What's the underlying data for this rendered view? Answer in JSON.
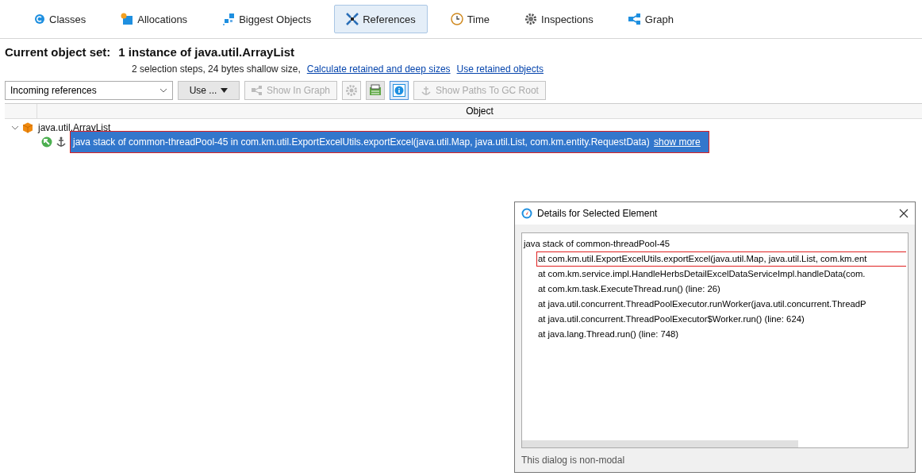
{
  "tabs": [
    {
      "label": "Classes",
      "selected": false
    },
    {
      "label": "Allocations",
      "selected": false
    },
    {
      "label": "Biggest Objects",
      "selected": false
    },
    {
      "label": "References",
      "selected": true
    },
    {
      "label": "Time",
      "selected": false
    },
    {
      "label": "Inspections",
      "selected": false
    },
    {
      "label": "Graph",
      "selected": false
    }
  ],
  "object_set": {
    "heading": "Current object set:",
    "value": "1 instance of java.util.ArrayList",
    "summary": "2 selection steps, 24 bytes shallow size,",
    "links": [
      "Calculate retained and deep sizes",
      "Use retained objects"
    ]
  },
  "toolbar": {
    "dropdown": {
      "value": "Incoming references"
    },
    "items": [
      {
        "kind": "menu",
        "label": "Use ...",
        "disabled": false
      },
      {
        "kind": "button",
        "label": "Show In Graph",
        "disabled": true
      },
      {
        "kind": "icon",
        "disabled": true,
        "selected": false
      },
      {
        "kind": "icon",
        "disabled": false,
        "selected": false
      },
      {
        "kind": "icon",
        "disabled": false,
        "selected": true
      },
      {
        "kind": "button",
        "label": "Show Paths To GC Root",
        "disabled": true
      }
    ]
  },
  "table": {
    "columns": [
      "Object"
    ],
    "rows": [
      {
        "label": "java.util.ArrayList",
        "expanded": true,
        "children": [
          {
            "label": "java stack of common-threadPool-45 in com.km.util.ExportExcelUtils.exportExcel(java.util.Map, java.util.List, com.km.entity.RequestData)",
            "link": "show more",
            "selected": true,
            "highlighted": true
          }
        ]
      }
    ]
  },
  "dialog": {
    "title": "Details for Selected Element",
    "lines": [
      {
        "text": "java stack of common-threadPool-45",
        "highlighted": false
      },
      {
        "text": "at com.km.util.ExportExcelUtils.exportExcel(java.util.Map, java.util.List, com.km.ent",
        "highlighted": true
      },
      {
        "text": "at com.km.service.impl.HandleHerbsDetailExcelDataServiceImpl.handleData(com.",
        "highlighted": false
      },
      {
        "text": "at com.km.task.ExecuteThread.run() (line: 26)",
        "highlighted": false
      },
      {
        "text": "at java.util.concurrent.ThreadPoolExecutor.runWorker(java.util.concurrent.ThreadP",
        "highlighted": false
      },
      {
        "text": "at java.util.concurrent.ThreadPoolExecutor$Worker.run() (line: 624)",
        "highlighted": false
      },
      {
        "text": "at java.lang.Thread.run() (line: 748)",
        "highlighted": false
      }
    ],
    "footer": "This dialog is non-modal"
  }
}
